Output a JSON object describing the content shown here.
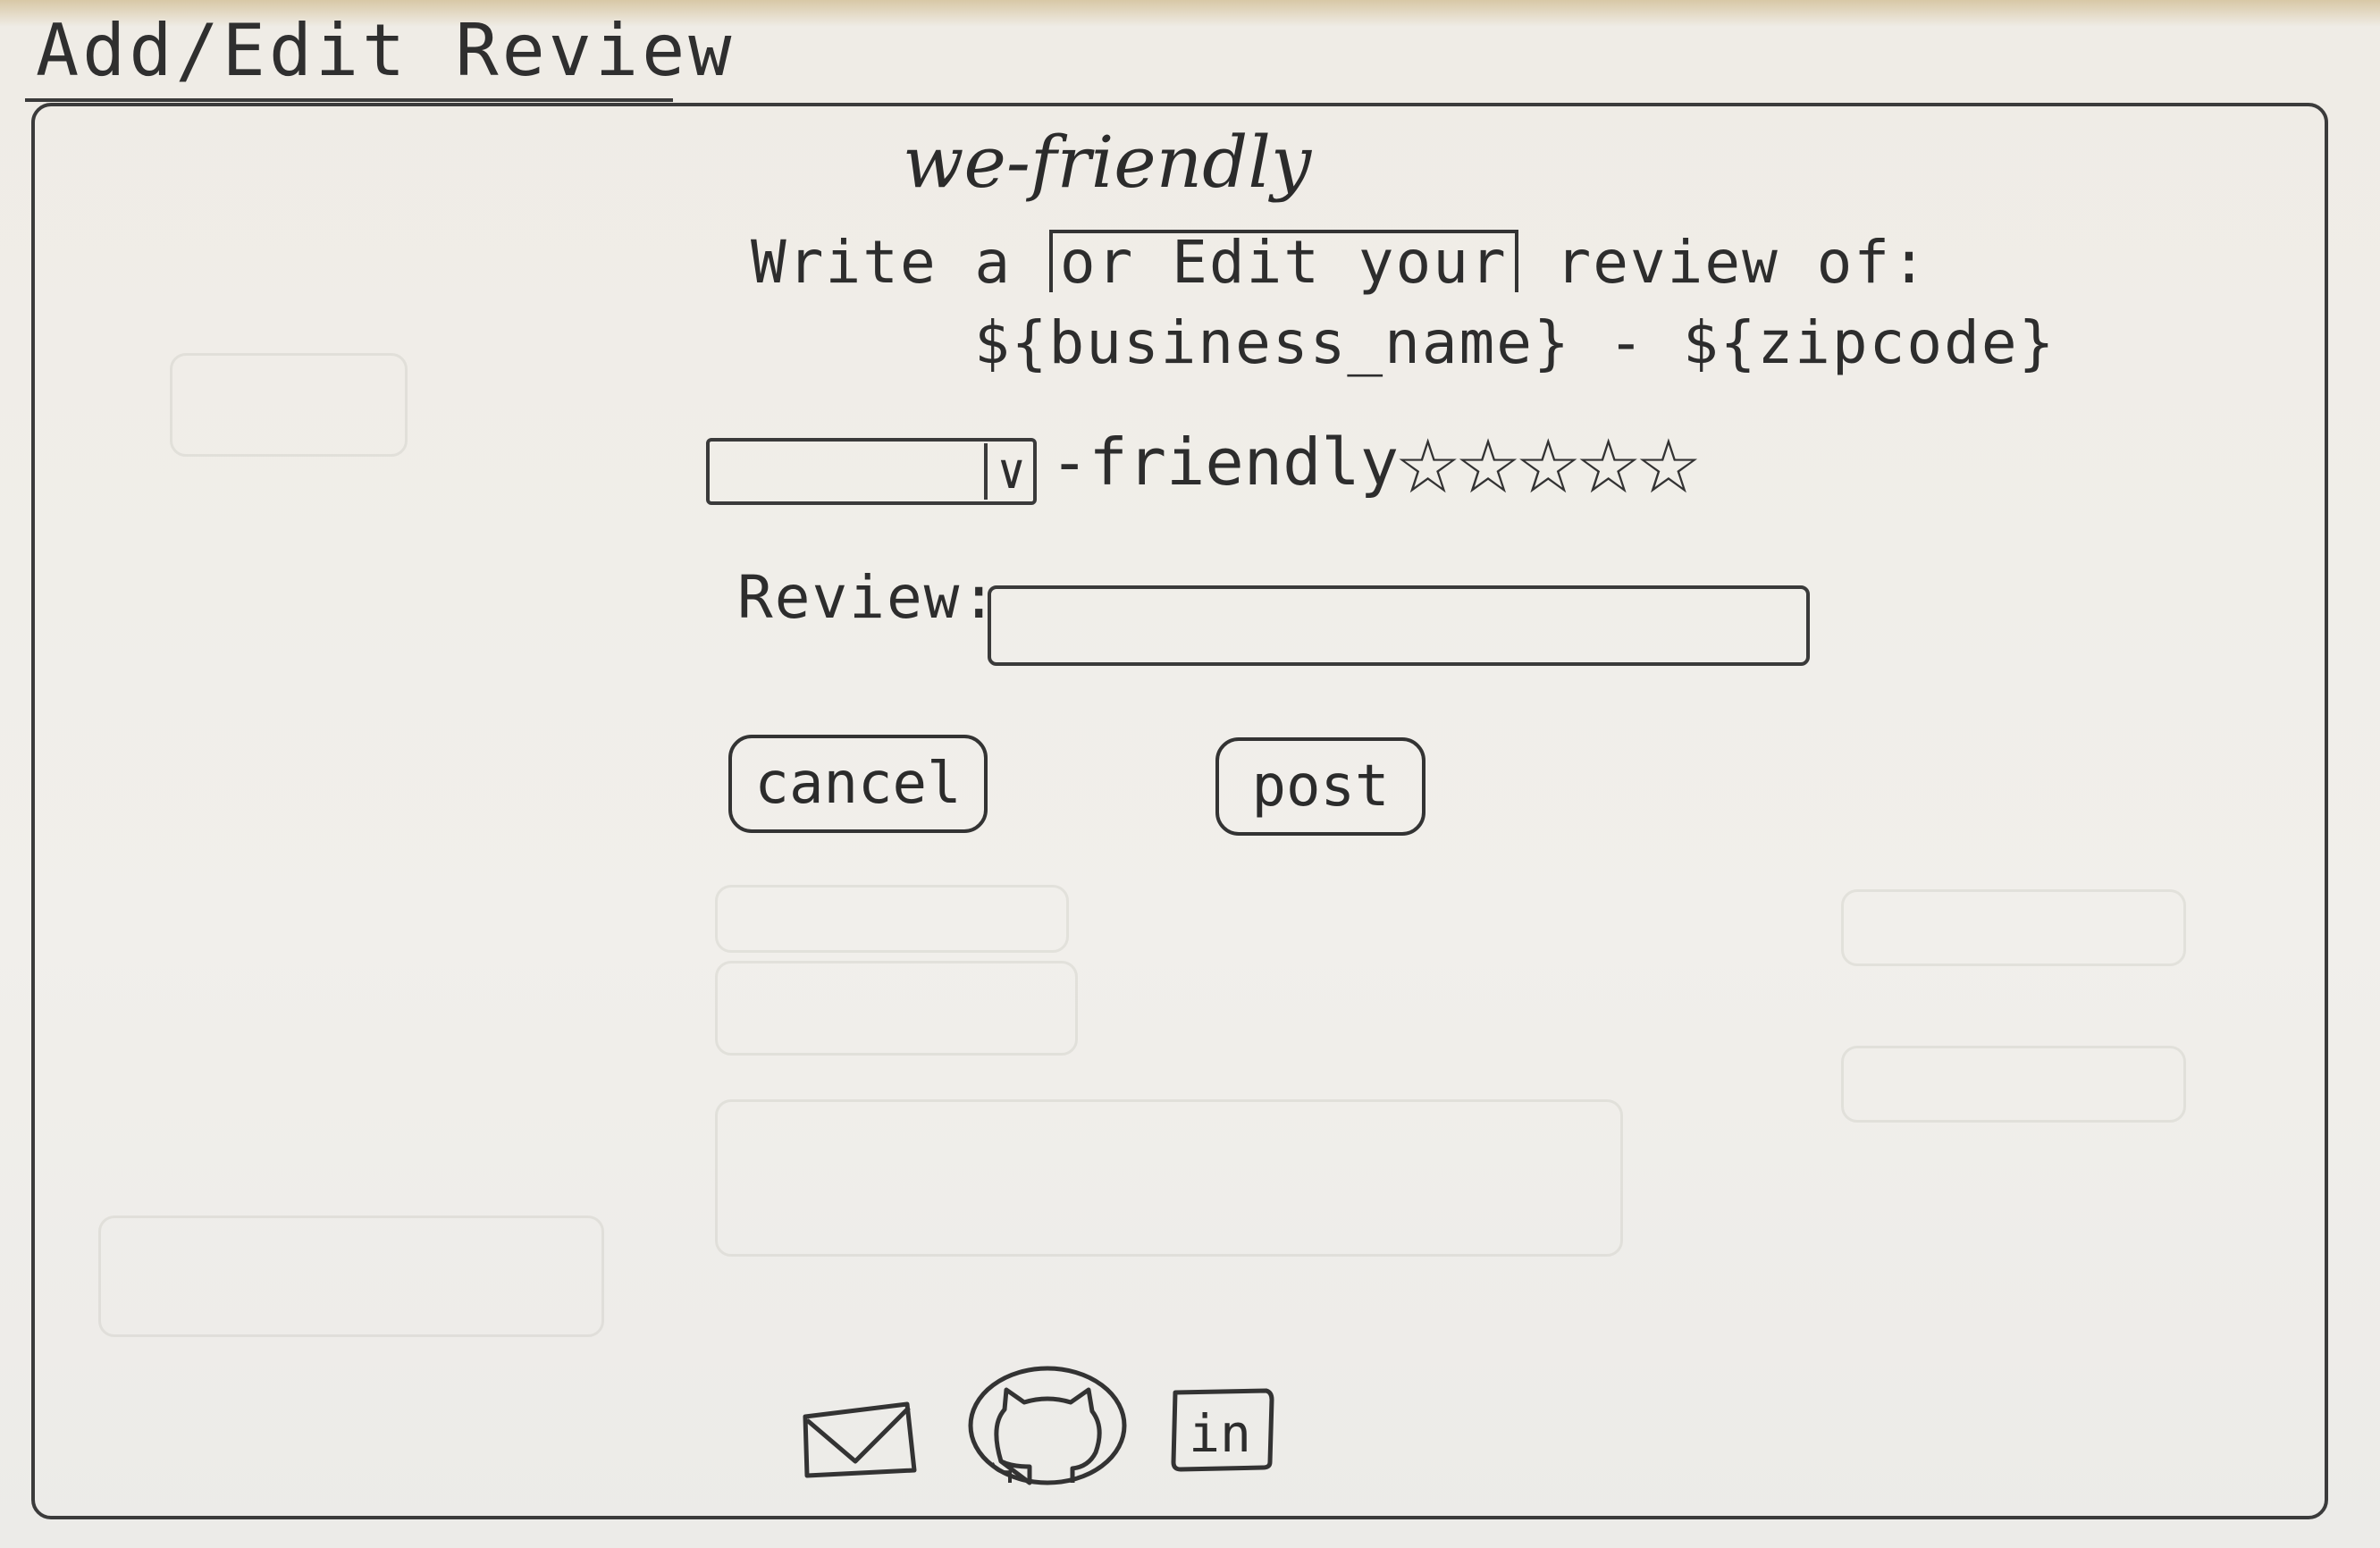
{
  "page": {
    "heading": "Add/Edit Review"
  },
  "form": {
    "brand": "we-friendly",
    "prompt_prefix": "Write a ",
    "prompt_bracket": "or Edit your",
    "prompt_suffix": " review of:",
    "target_template": "${business_name} - ${zipcode}",
    "category_select_value": "",
    "rating_label": "-friendly",
    "rating_max": 5,
    "review_label": "Review:",
    "review_value": "",
    "review_placeholder": "",
    "cancel_label": "cancel",
    "post_label": "post"
  },
  "footer": {
    "icons": [
      "mail-icon",
      "github-icon",
      "linkedin-icon"
    ],
    "linkedin_text": "in"
  }
}
